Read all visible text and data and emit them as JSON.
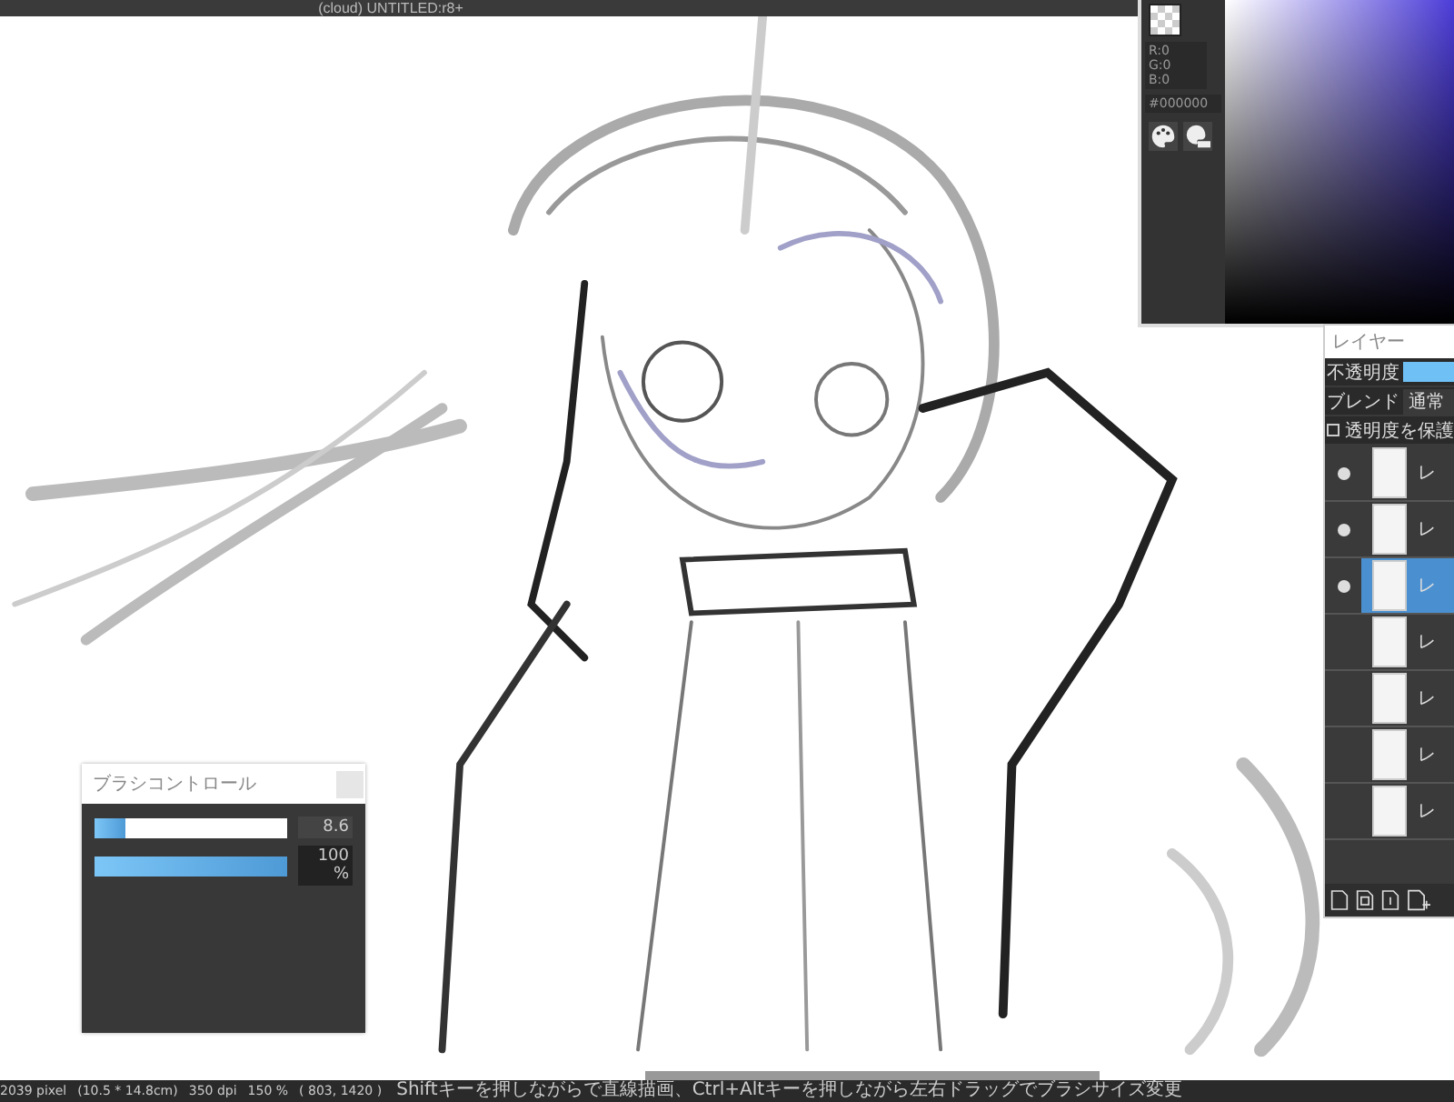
{
  "window": {
    "title": "(cloud) UNTITLED:r8+"
  },
  "color_panel": {
    "rgb": [
      "R:0",
      "G:0",
      "B:0"
    ],
    "hex": "#000000"
  },
  "layers_panel": {
    "title": "レイヤー",
    "opacity_label": "不透明度",
    "opacity": {
      "level": 1
    },
    "blend_label": "ブレンド",
    "blend_mode": "通常",
    "protect_alpha": {
      "label": "透明度を保護",
      "checked": false
    },
    "layers": [
      {
        "name": "レ",
        "visible": true,
        "selected": false
      },
      {
        "name": "レ",
        "visible": true,
        "selected": false
      },
      {
        "name": "レ",
        "visible": true,
        "selected": true
      },
      {
        "name": "レ",
        "visible": false,
        "selected": false
      },
      {
        "name": "レ",
        "visible": false,
        "selected": false
      },
      {
        "name": "レ",
        "visible": false,
        "selected": false
      },
      {
        "name": "レ",
        "visible": false,
        "selected": false
      }
    ]
  },
  "brush_control": {
    "title": "ブラシコントロール",
    "sliders": [
      {
        "level": 0.16,
        "reading": "8.6"
      },
      {
        "level": 1,
        "reading": "100 %"
      }
    ]
  },
  "status_bar": {
    "size": "2039 pixel",
    "paper": "(10.5 * 14.8cm)",
    "dpi": "350 dpi",
    "zoom": "150 %",
    "cursor": "( 803, 1420 )",
    "hint": "Shiftキーを押しながらで直線描画、Ctrl+Altキーを押しながら左右ドラッグでブラシサイズ変更"
  }
}
